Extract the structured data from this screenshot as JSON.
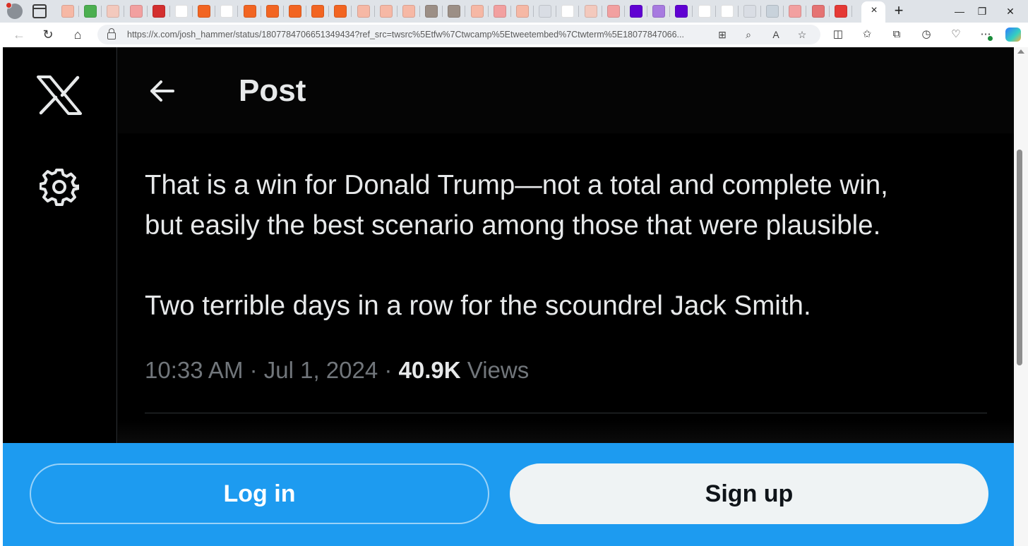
{
  "browser": {
    "tab_favicons": [
      {
        "color": "#f6b8a5"
      },
      {
        "color": "#4caf50"
      },
      {
        "color": "#f3c9bd"
      },
      {
        "color": "#f2a0a0"
      },
      {
        "color": "#d32f2f"
      },
      {
        "color": "#ffffff"
      },
      {
        "color": "#f26522"
      },
      {
        "color": "#ffffff"
      },
      {
        "color": "#f26522"
      },
      {
        "color": "#f26522"
      },
      {
        "color": "#f26522"
      },
      {
        "color": "#f26522"
      },
      {
        "color": "#f26522"
      },
      {
        "color": "#f6b8a5"
      },
      {
        "color": "#f6b8a5"
      },
      {
        "color": "#f6b8a5"
      },
      {
        "color": "#9c8f86"
      },
      {
        "color": "#9c8f86"
      },
      {
        "color": "#f6b8a5"
      },
      {
        "color": "#f2a0a0"
      },
      {
        "color": "#f6b8a5"
      },
      {
        "color": "#d9dde4"
      },
      {
        "color": "#ffffff"
      },
      {
        "color": "#f3c9bd"
      },
      {
        "color": "#f2a0a0"
      },
      {
        "color": "#6001d2"
      },
      {
        "color": "#a77ae0"
      },
      {
        "color": "#6001d2"
      },
      {
        "color": "#ffffff"
      },
      {
        "color": "#ffffff"
      },
      {
        "color": "#d9dde4"
      },
      {
        "color": "#c8d2db"
      },
      {
        "color": "#f2a0a0"
      },
      {
        "color": "#e57373"
      },
      {
        "color": "#e53935"
      }
    ],
    "active_tab_close": "×",
    "new_tab_label": "+",
    "window_controls": {
      "minimize": "—",
      "restore": "❐",
      "close": "✕"
    },
    "url": "https://x.com/josh_hammer/status/1807784706651349434?ref_src=twsrc%5Etfw%7Ctwcamp%5Etweetembed%7Ctwterm%5E18077847066..."
  },
  "page": {
    "title": "Post",
    "tweet_lines": [
      "That is a win for Donald Trump—not a total and complete win,",
      "but easily the best scenario among those that were plausible."
    ],
    "tweet_line_3": "Two terrible days in a row for the scoundrel Jack Smith.",
    "timestamp": "10:33 AM · Jul 1, 2024 ·",
    "views_count": "40.9K",
    "views_label": "Views"
  },
  "cta": {
    "login_label": "Log in",
    "signup_label": "Sign up"
  },
  "colors": {
    "background": "#000000",
    "text": "#e7e9ea",
    "muted": "#71767b",
    "accent": "#1d9bf0"
  }
}
